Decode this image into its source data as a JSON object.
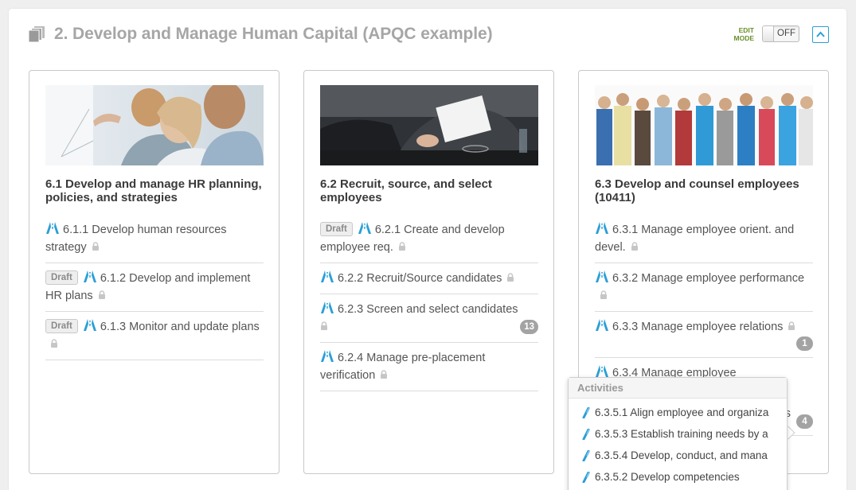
{
  "header": {
    "title": "2. Develop and Manage Human Capital (APQC example)",
    "edit_mode_label": "EDIT MODE",
    "toggle_state": "OFF"
  },
  "colors": {
    "accent": "#2a9fd6",
    "edit_mode": "#6a8f2c",
    "badge": "#a3a3a3"
  },
  "cards": [
    {
      "title": "6.1 Develop and manage HR planning, policies, and strategies",
      "image": "office-meeting-photo",
      "items": [
        {
          "draft": "",
          "label": "6.1.1 Develop human resources strategy",
          "count": ""
        },
        {
          "draft": "Draft",
          "label": "6.1.2 Develop and implement HR plans",
          "count": ""
        },
        {
          "draft": "Draft",
          "label": "6.1.3 Monitor and update plans",
          "count": ""
        }
      ]
    },
    {
      "title": "6.2 Recruit, source, and select employees",
      "image": "interview-photo",
      "items": [
        {
          "draft": "Draft",
          "label": "6.2.1 Create and develop employee req.",
          "count": ""
        },
        {
          "draft": "",
          "label": "6.2.2 Recruit/Source candidates",
          "count": ""
        },
        {
          "draft": "",
          "label": "6.2.3 Screen and select candidates",
          "count": "13"
        },
        {
          "draft": "",
          "label": "6.2.4 Manage pre-placement verification",
          "count": ""
        }
      ]
    },
    {
      "title": "6.3 Develop and counsel employees (10411)",
      "image": "team-group-photo",
      "items": [
        {
          "draft": "",
          "label": "6.3.1 Manage employee orient. and devel.",
          "count": ""
        },
        {
          "draft": "",
          "label": "6.3.2 Manage employee performance",
          "count": ""
        },
        {
          "draft": "",
          "label": "6.3.3 Manage employee relations",
          "count": "1"
        },
        {
          "draft": "",
          "label": "6.3.4 Manage employee",
          "count": ""
        },
        {
          "draft": "",
          "label": "es",
          "count": "4"
        }
      ]
    }
  ],
  "popup": {
    "title": "Activities",
    "activities": [
      "6.3.5.1 Align employee and organiza",
      "6.3.5.3 Establish training needs by a",
      "6.3.5.4 Develop, conduct, and mana",
      "6.3.5.2 Develop competencies"
    ]
  }
}
